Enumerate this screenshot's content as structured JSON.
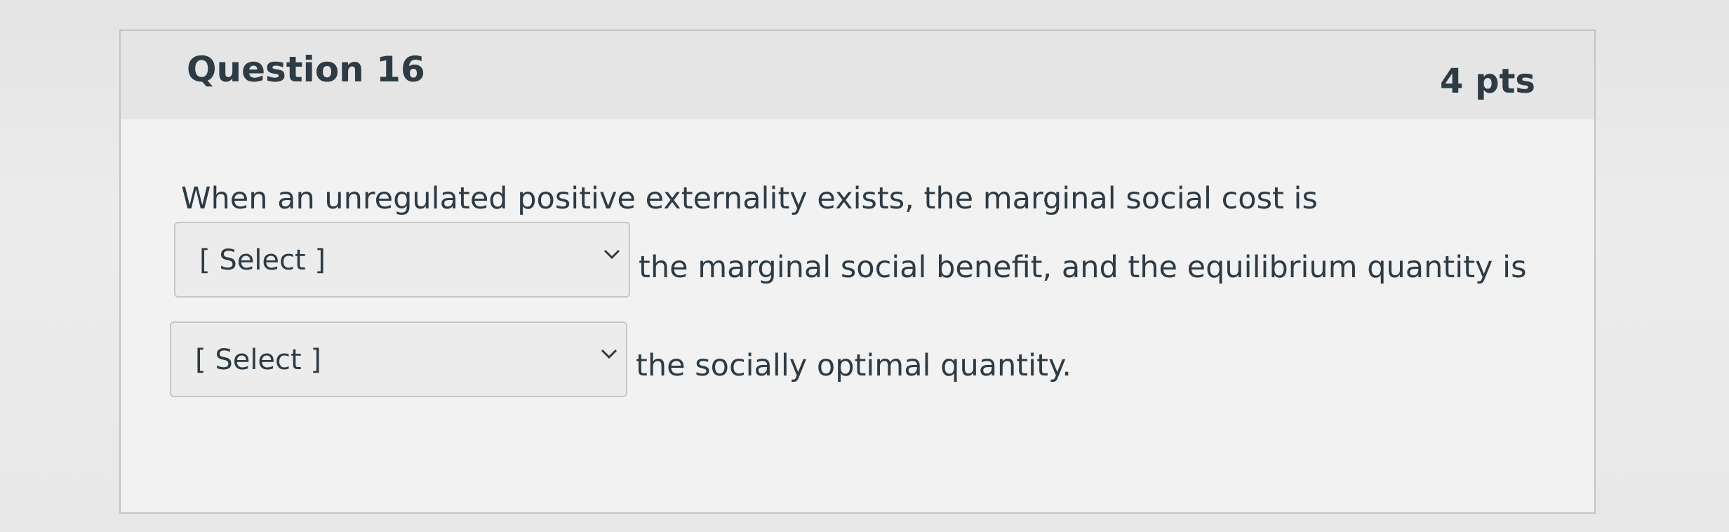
{
  "question": {
    "title": "Question 16",
    "points": "4 pts",
    "prompt_line1": "When an unregulated positive externality exists, the marginal social cost is",
    "prompt_line2": "the marginal social benefit, and the equilibrium quantity is",
    "prompt_line3": "the socially optimal quantity.",
    "select1": {
      "value": "[ Select ]",
      "icon": "chevron-down-icon"
    },
    "select2": {
      "value": "[ Select ]",
      "icon": "chevron-down-icon"
    }
  }
}
